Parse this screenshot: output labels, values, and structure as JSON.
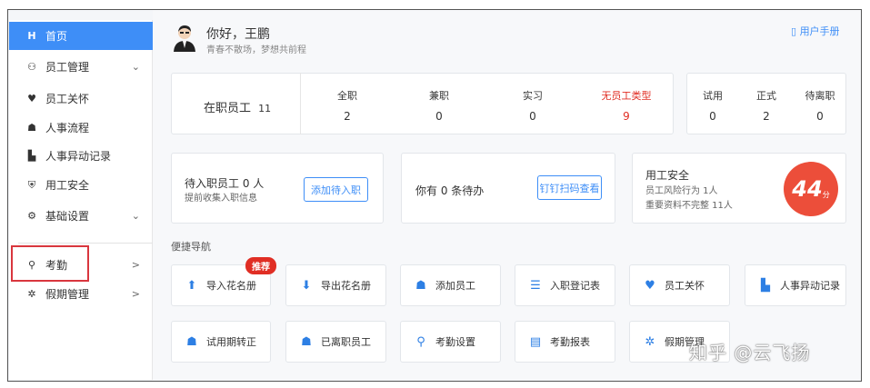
{
  "sidebar": {
    "items": [
      {
        "label": "首页",
        "icon": "home-icon",
        "glyph": "H"
      },
      {
        "label": "员工管理",
        "icon": "employees-icon",
        "glyph": "⚇"
      },
      {
        "label": "员工关怀",
        "icon": "heart-icon",
        "glyph": "♥"
      },
      {
        "label": "人事流程",
        "icon": "person-icon",
        "glyph": "☗"
      },
      {
        "label": "人事异动记录",
        "icon": "document-icon",
        "glyph": "▙"
      },
      {
        "label": "用工安全",
        "icon": "shield-icon",
        "glyph": "⛨"
      },
      {
        "label": "基础设置",
        "icon": "gear-icon",
        "glyph": "⚙"
      },
      {
        "label": "考勤",
        "icon": "location-icon",
        "glyph": "⚲"
      },
      {
        "label": "假期管理",
        "icon": "palm-icon",
        "glyph": "✲"
      }
    ],
    "expand_arrow": "⌄",
    "right_arrow": ">"
  },
  "header": {
    "hello": "你好，王鹏",
    "motto": "青春不散场，梦想共前程",
    "manual": "用户手册"
  },
  "stats": {
    "onjob_label": "在职员工",
    "onjob_count": "11",
    "types": [
      {
        "label": "全职",
        "value": "2"
      },
      {
        "label": "兼职",
        "value": "0"
      },
      {
        "label": "实习",
        "value": "0"
      },
      {
        "label": "无员工类型",
        "value": "9"
      }
    ],
    "status": [
      {
        "label": "试用",
        "value": "0"
      },
      {
        "label": "正式",
        "value": "2"
      },
      {
        "label": "待离职",
        "value": "0"
      }
    ]
  },
  "pending": {
    "title": "待入职员工 0 人",
    "sub": "提前收集入职信息",
    "button": "添加待入职"
  },
  "todo": {
    "text": "你有 0 条待办",
    "button": "钉钉扫码查看"
  },
  "safety": {
    "title": "用工安全",
    "line1": "员工风险行为 1人",
    "line2": "重要资料不完整 11人",
    "score": "44",
    "unit": "分"
  },
  "quicknav": {
    "title": "便捷导航",
    "badge": "推荐",
    "items": [
      {
        "label": "导入花名册",
        "glyph": "⬆"
      },
      {
        "label": "导出花名册",
        "glyph": "⬇"
      },
      {
        "label": "添加员工",
        "glyph": "☗"
      },
      {
        "label": "入职登记表",
        "glyph": "☰"
      },
      {
        "label": "员工关怀",
        "glyph": "♥"
      },
      {
        "label": "人事异动记录",
        "glyph": "▙"
      },
      {
        "label": "试用期转正",
        "glyph": "☗"
      },
      {
        "label": "已离职员工",
        "glyph": "☗"
      },
      {
        "label": "考勤设置",
        "glyph": "⚲"
      },
      {
        "label": "考勤报表",
        "glyph": "▤"
      },
      {
        "label": "假期管理",
        "glyph": "✲"
      }
    ]
  },
  "watermark": "知乎 @云飞扬",
  "colors": {
    "accent": "#3e8ef7",
    "red": "#e02e24",
    "score_bg": "#ec4e3a"
  }
}
